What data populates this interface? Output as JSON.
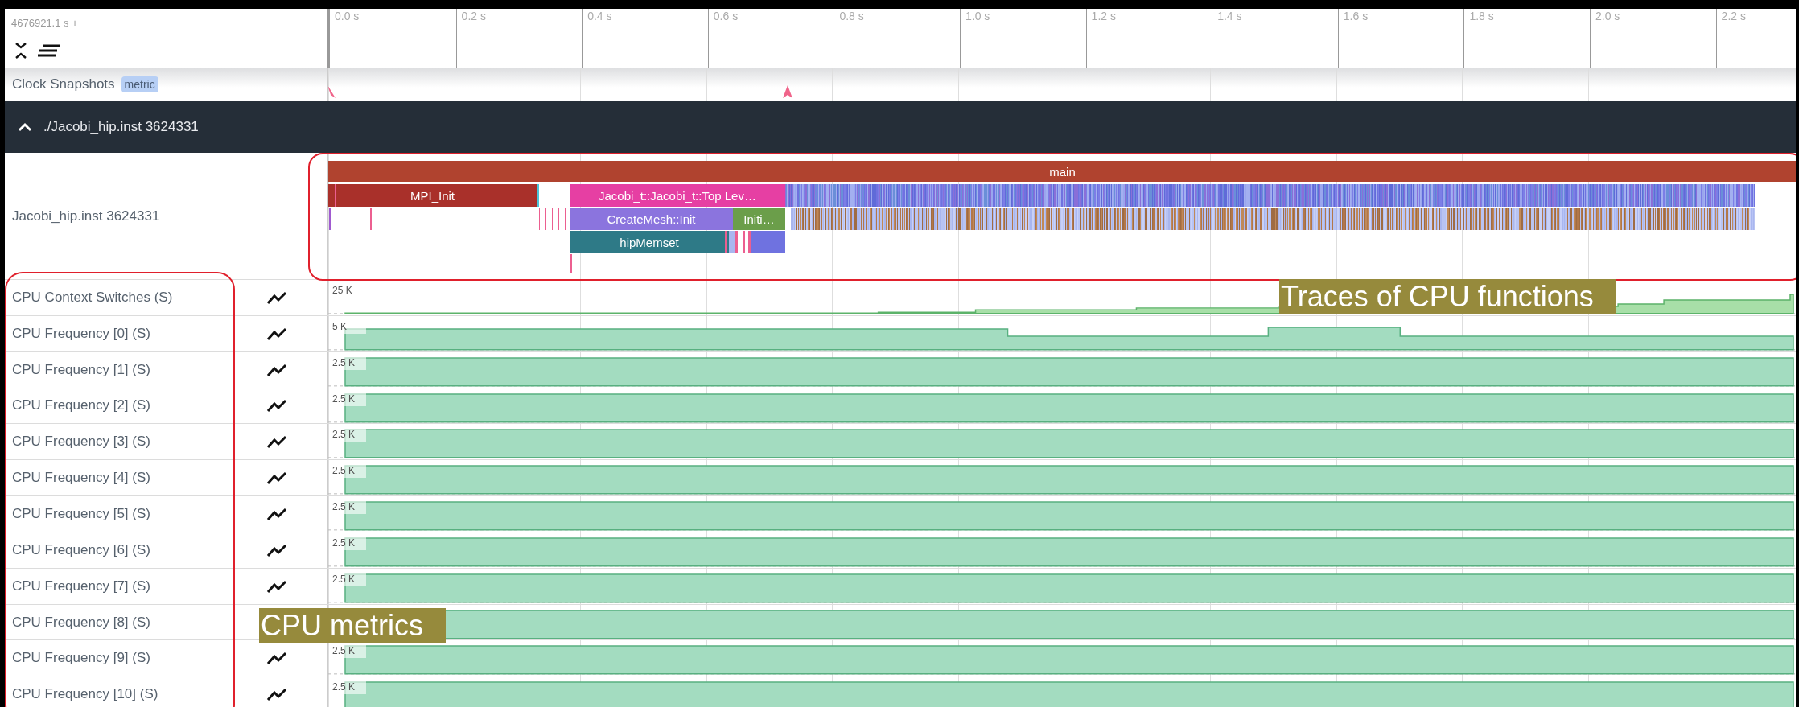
{
  "timeline": {
    "offset": "4676921.1 s +",
    "ticks": [
      "0.0 s",
      "0.2 s",
      "0.4 s",
      "0.6 s",
      "0.8 s",
      "1.0 s",
      "1.2 s",
      "1.4 s",
      "1.6 s",
      "1.8 s",
      "2.0 s",
      "2.2 s"
    ]
  },
  "clock_snapshots": {
    "label": "Clock Snapshots",
    "tag": "metric"
  },
  "process": {
    "title": "./Jacobi_hip.inst 3624331",
    "expanded": true,
    "thread": {
      "label": "Jacobi_hip.inst 3624331",
      "slices": [
        {
          "label": "main",
          "color": "#b0432f",
          "children": [
            {
              "label": "MPI_Init",
              "color": "#a9302a"
            },
            {
              "label": "Jacobi_t::Jacobi_t::Top Lev…",
              "color": "#e63fa3",
              "children": [
                {
                  "label": "CreateMesh::Init",
                  "color": "#8b74de",
                  "children": [
                    {
                      "label": "hipMemset",
                      "color": "#2e7a87"
                    }
                  ]
                },
                {
                  "label": "Initi…",
                  "color": "#6b9e4a"
                }
              ]
            }
          ]
        }
      ]
    },
    "counters": [
      {
        "label": "CPU Context Switches (S)",
        "reading": "25 K"
      },
      {
        "label": "CPU Frequency [0] (S)",
        "reading": "5 K"
      },
      {
        "label": "CPU Frequency [1] (S)",
        "reading": "2.5 K"
      },
      {
        "label": "CPU Frequency [2] (S)",
        "reading": "2.5 K"
      },
      {
        "label": "CPU Frequency [3] (S)",
        "reading": "2.5 K"
      },
      {
        "label": "CPU Frequency [4] (S)",
        "reading": "2.5 K"
      },
      {
        "label": "CPU Frequency [5] (S)",
        "reading": "2.5 K"
      },
      {
        "label": "CPU Frequency [6] (S)",
        "reading": "2.5 K"
      },
      {
        "label": "CPU Frequency [7] (S)",
        "reading": "2.5 K"
      },
      {
        "label": "CPU Frequency [8] (S)"
      },
      {
        "label": "CPU Frequency [9] (S)",
        "reading": "2.5 K"
      },
      {
        "label": "CPU Frequency [10] (S)",
        "reading": "2.5 K"
      }
    ]
  },
  "annotations": [
    {
      "text": "Traces of CPU functions"
    },
    {
      "text": "CPU metrics"
    }
  ]
}
